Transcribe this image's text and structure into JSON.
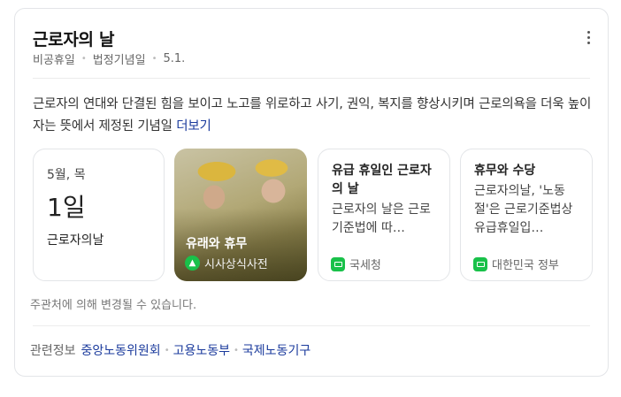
{
  "header": {
    "title": "근로자의 날",
    "meta": [
      "비공휴일",
      "법정기념일",
      "5.1."
    ]
  },
  "description": {
    "text": "근로자의 연대와 단결된 힘을 보이고 노고를 위로하고 사기, 권익, 복지를 향상시키며 근로의욕을 더욱 높이자는 뜻에서 제정된 기념일",
    "more_link": "더보기"
  },
  "cards": {
    "date": {
      "weekday": "5월, 목",
      "day": "1일",
      "name": "근로자의날"
    },
    "photo": {
      "title": "유래와 휴무",
      "source": "시사상식사전",
      "source_icon": "graduation-cap-icon"
    },
    "holiday": {
      "title": "유급 휴일인 근로자의 날",
      "text": "근로자의 날은 근로기준법에 따…",
      "source": "국세청",
      "source_icon": "chat-box-icon"
    },
    "allowance": {
      "title": "휴무와 수당",
      "text": "근로자의날, '노동절'은 근로기준법상 유급휴일입…",
      "source": "대한민국 정부",
      "source_icon": "chat-box-icon"
    }
  },
  "notice": "주관처에 의해 변경될 수 있습니다.",
  "related": {
    "label": "관련정보",
    "links": [
      "중앙노동위원회",
      "고용노동부",
      "국제노동기구"
    ]
  },
  "colors": {
    "link": "#1a3a9c",
    "source_green": "#19c14a"
  }
}
